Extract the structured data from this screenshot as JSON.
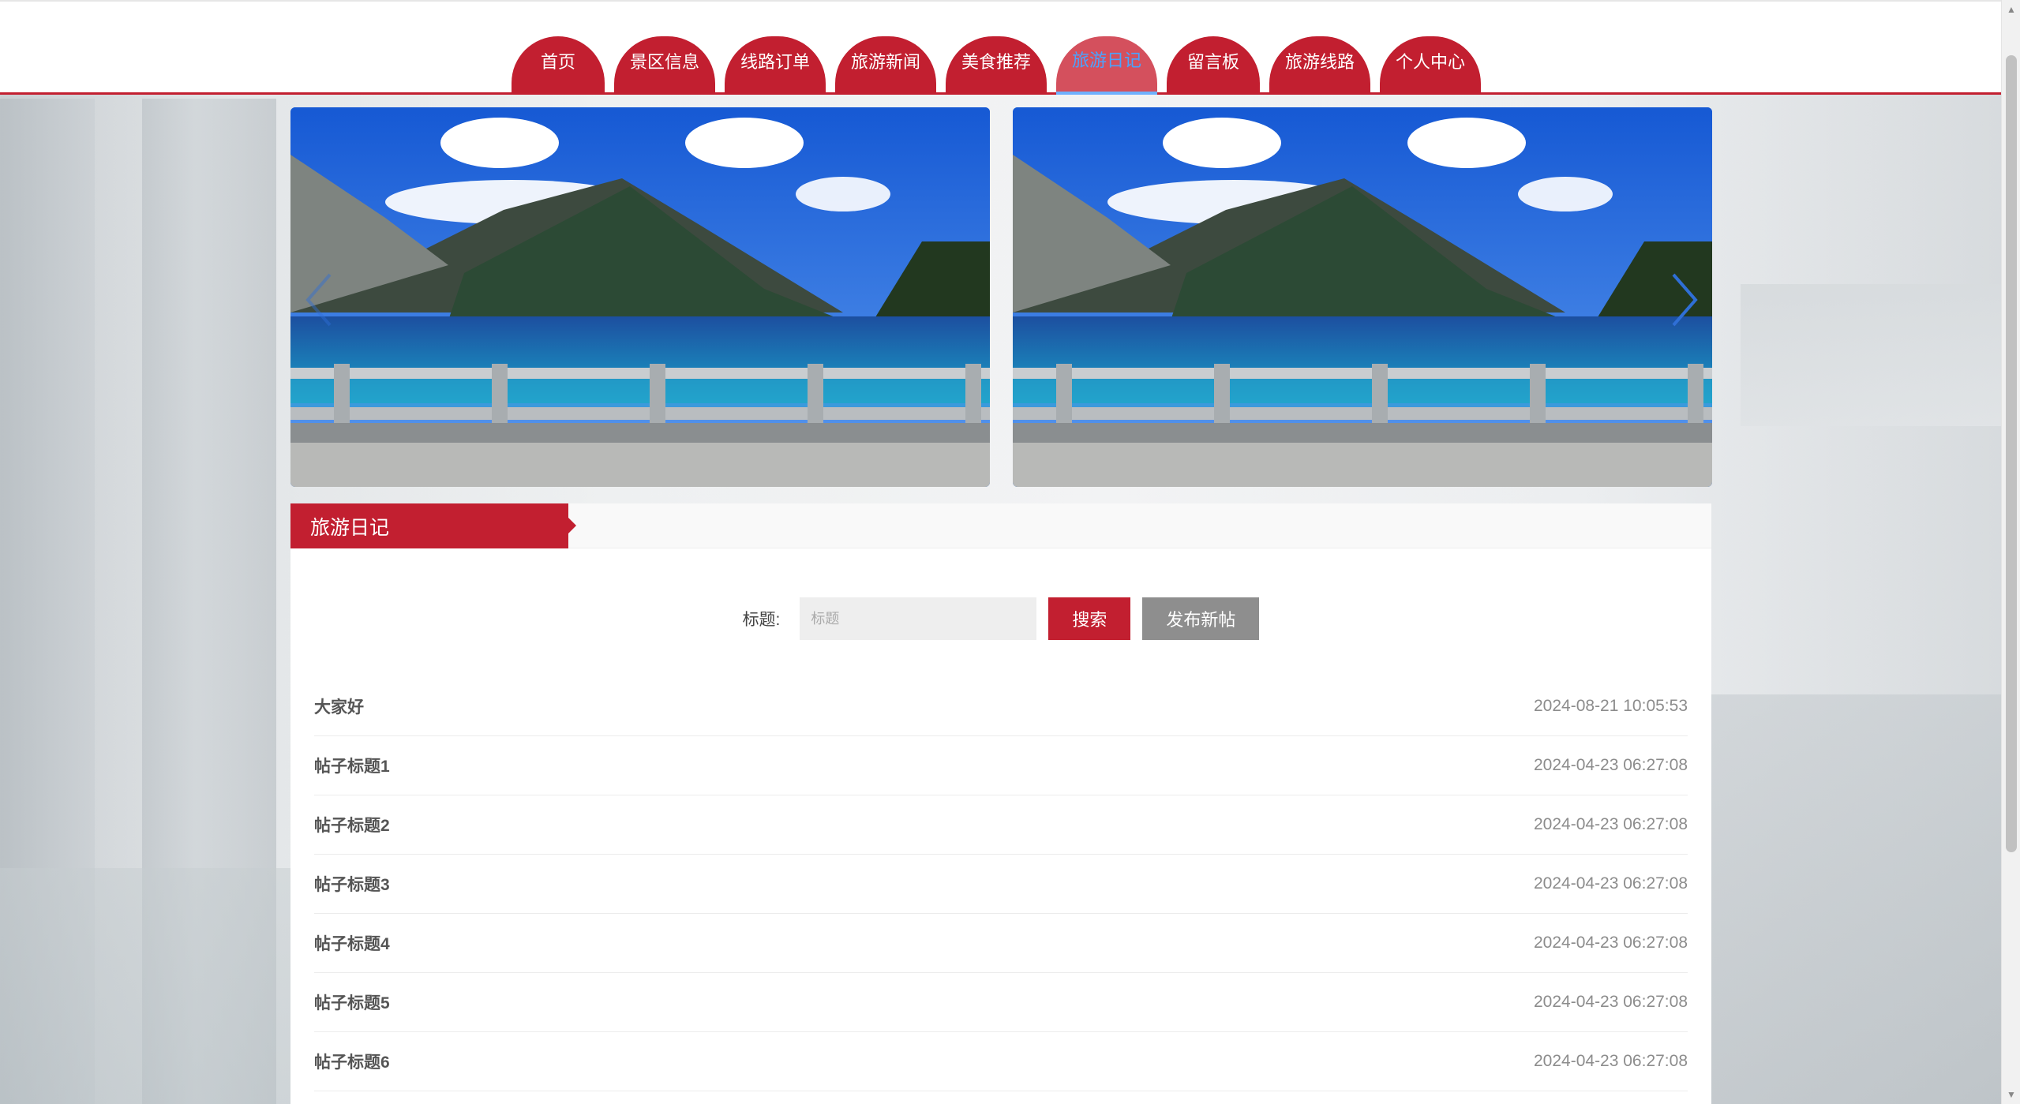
{
  "nav": {
    "items": [
      {
        "label": "首页",
        "active": false
      },
      {
        "label": "景区信息",
        "active": false
      },
      {
        "label": "线路订单",
        "active": false
      },
      {
        "label": "旅游新闻",
        "active": false
      },
      {
        "label": "美食推荐",
        "active": false
      },
      {
        "label": "旅游日记",
        "active": true
      },
      {
        "label": "留言板",
        "active": false
      },
      {
        "label": "旅游线路",
        "active": false
      },
      {
        "label": "个人中心",
        "active": false
      }
    ]
  },
  "carousel": {
    "prev_icon": "chevron-left-icon",
    "next_icon": "chevron-right-icon"
  },
  "section": {
    "title": "旅游日记"
  },
  "search": {
    "label": "标题:",
    "placeholder": "标题",
    "value": "",
    "search_button": "搜索",
    "new_post_button": "发布新帖"
  },
  "posts": [
    {
      "title": "大家好",
      "time": "2024-08-21 10:05:53"
    },
    {
      "title": "帖子标题1",
      "time": "2024-04-23 06:27:08"
    },
    {
      "title": "帖子标题2",
      "time": "2024-04-23 06:27:08"
    },
    {
      "title": "帖子标题3",
      "time": "2024-04-23 06:27:08"
    },
    {
      "title": "帖子标题4",
      "time": "2024-04-23 06:27:08"
    },
    {
      "title": "帖子标题5",
      "time": "2024-04-23 06:27:08"
    },
    {
      "title": "帖子标题6",
      "time": "2024-04-23 06:27:08"
    }
  ],
  "colors": {
    "brand_red": "#c21f30",
    "active_tab_text": "#4aa3ff",
    "new_post_button": "#8e8e8e"
  }
}
